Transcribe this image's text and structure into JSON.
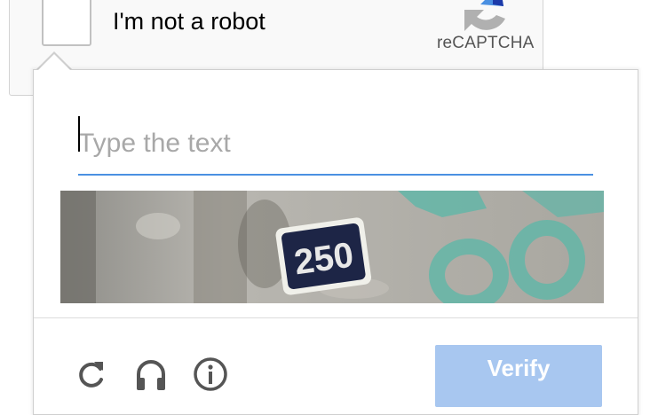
{
  "anchor": {
    "checkbox_label": "I'm not a robot",
    "logo_text": "reCAPTCHA",
    "logo_icon": "recaptcha-logo-icon"
  },
  "challenge": {
    "input_value": "",
    "input_placeholder": "Type the text",
    "image_text": "250",
    "footer_icons": [
      "reload-icon",
      "headphones-icon",
      "info-icon"
    ],
    "verify_label": "Verify"
  },
  "colors": {
    "input_underline": "#4a90e2",
    "verify_button": "#a8c7f0",
    "logo_blue": "#4a90e2",
    "logo_dark_blue": "#1c3aa9"
  }
}
